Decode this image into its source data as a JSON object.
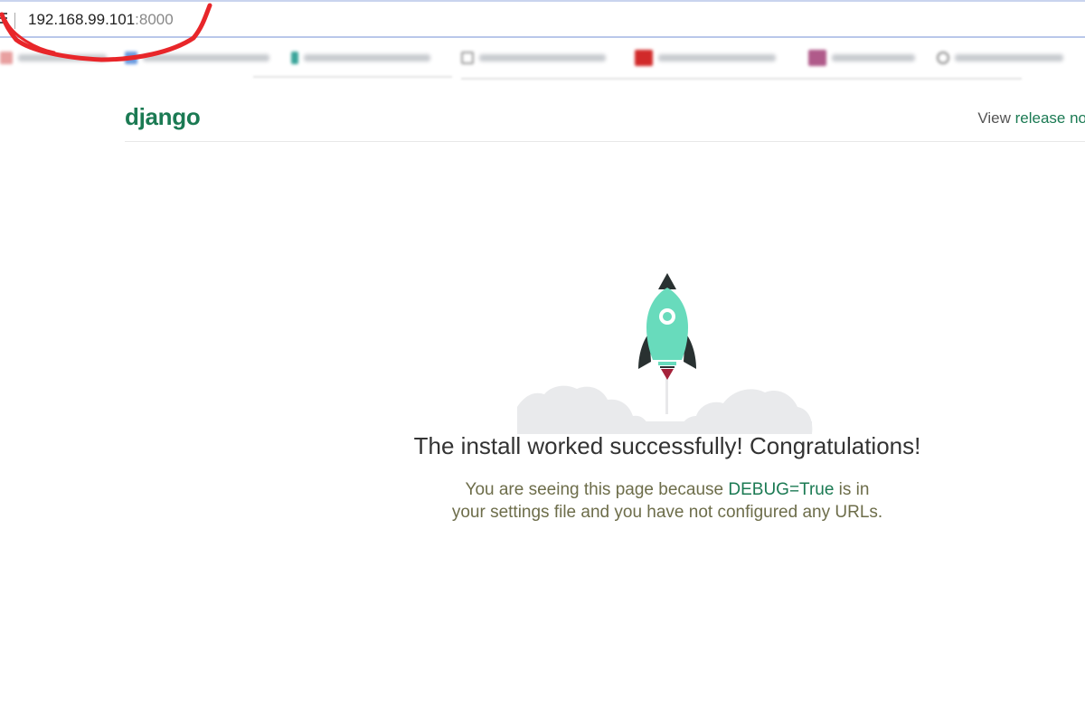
{
  "browser": {
    "url_host": "192.168.99.101",
    "url_port": ":8000"
  },
  "header": {
    "logo": "django",
    "release_prefix": "View ",
    "release_link": "release no"
  },
  "main": {
    "headline": "The install worked successfully! Congratulations!",
    "sub_before": "You are seeing this page because ",
    "sub_debug": "DEBUG=True",
    "sub_after": " is in your settings file and you have not configured any URLs."
  },
  "colors": {
    "brand_green": "#1b7a53",
    "rocket_body": "#68dbbc",
    "rocket_dark": "#293131",
    "annotation_red": "#e8262a"
  }
}
